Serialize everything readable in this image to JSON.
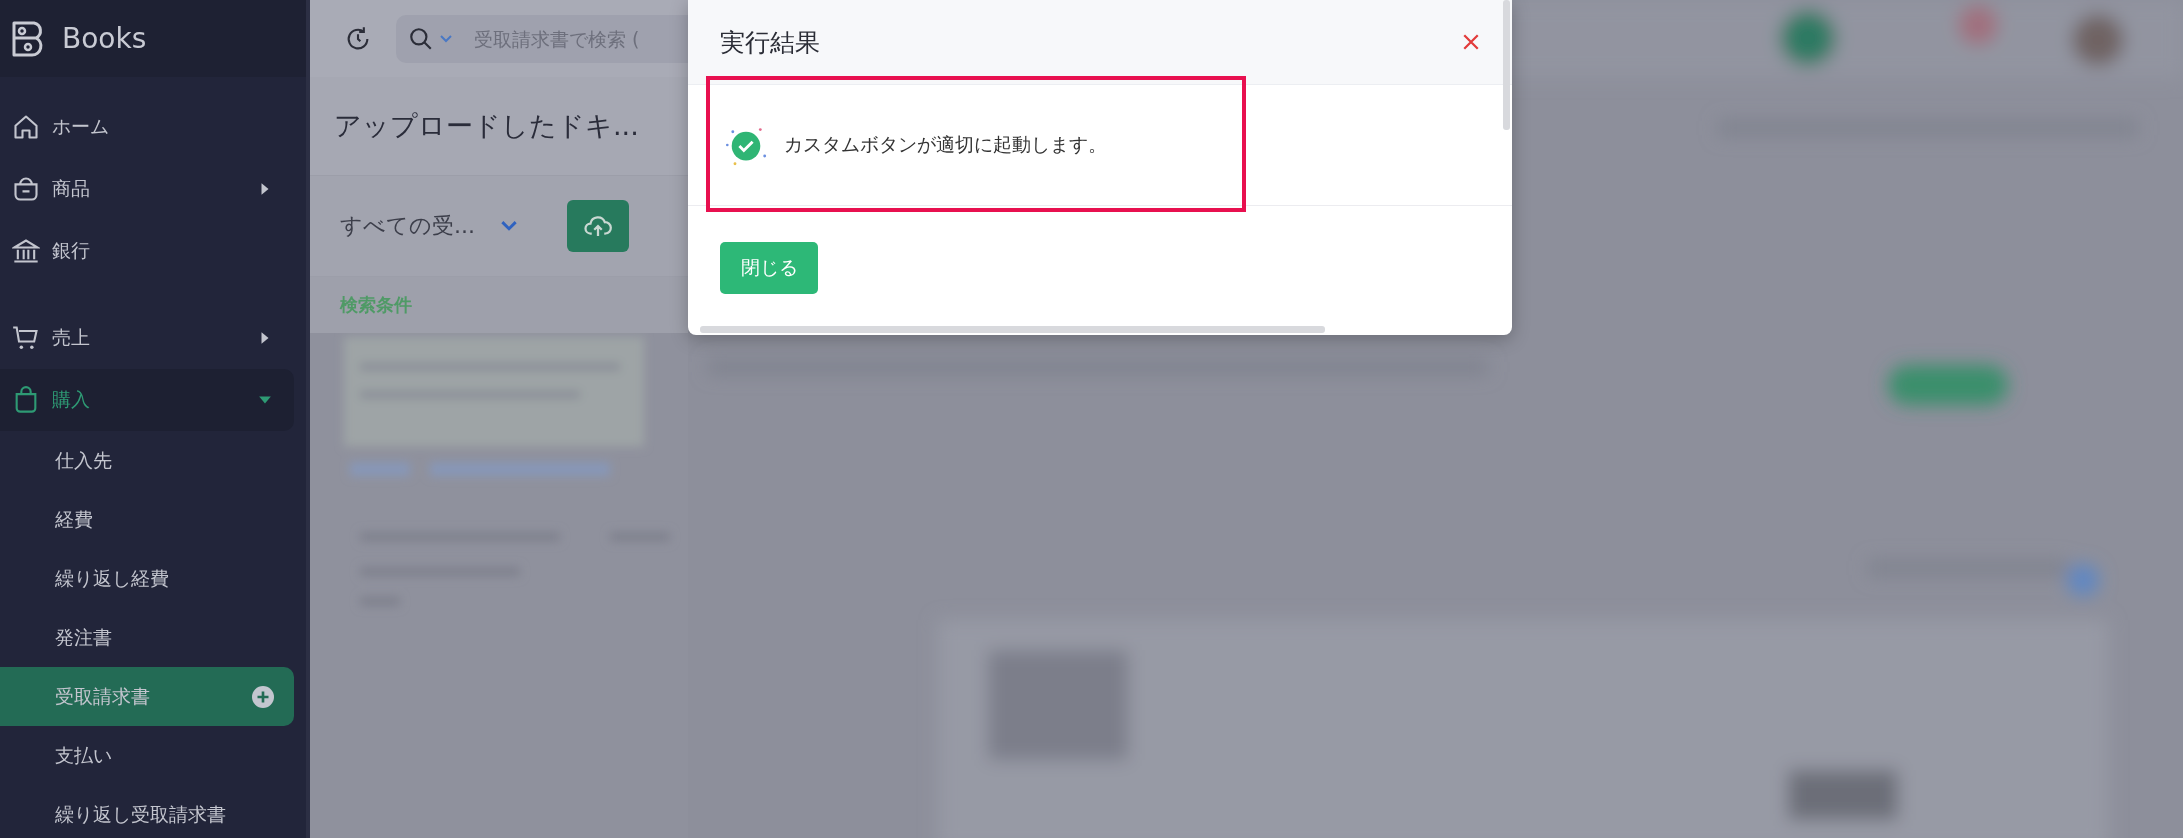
{
  "sidebar": {
    "brand": "Books",
    "items": [
      {
        "label": "ホーム",
        "kind": "link",
        "selected": false
      },
      {
        "label": "商品",
        "kind": "group",
        "expanded": false,
        "selected": false
      },
      {
        "label": "銀行",
        "kind": "link",
        "selected": false
      },
      {
        "label": "売上",
        "kind": "group",
        "expanded": false,
        "selected": false
      },
      {
        "label": "購入",
        "kind": "group",
        "expanded": true,
        "selected": true,
        "children": [
          {
            "label": "仕入先",
            "selected": false
          },
          {
            "label": "経費",
            "selected": false
          },
          {
            "label": "繰り返し経費",
            "selected": false
          },
          {
            "label": "発注書",
            "selected": false
          },
          {
            "label": "受取請求書",
            "selected": true
          },
          {
            "label": "支払い",
            "selected": false
          },
          {
            "label": "繰り返し受取請求書",
            "selected": false
          }
        ]
      }
    ]
  },
  "top_bar": {
    "search": {
      "placeholder": "受取請求書で検索 ("
    }
  },
  "page": {
    "title": "アップロードしたドキ...",
    "view_selector": "すべての受...",
    "filter_heading": "検索条件"
  },
  "dialog": {
    "title": "実行結果",
    "message": "カスタムボタンが適切に起動します。",
    "close_button": "閉じる"
  }
}
